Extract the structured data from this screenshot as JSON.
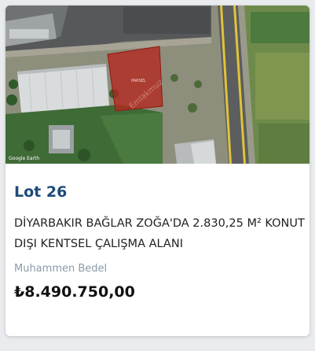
{
  "listing": {
    "image_caption": "Google Earth",
    "parcel_label": "PARSEL",
    "lot_label": "Lot 26",
    "title": "DİYARBAKIR BAĞLAR ZOĞA'DA 2.830,25 M² KONUT DIŞI KENTSEL ÇALIŞMA ALANI",
    "estimate_label": "Muhammen Bedel",
    "price": "₺8.490.750,00"
  },
  "colors": {
    "lot_title": "#1d4a7a",
    "estimate_label": "#8a9aa9",
    "parcel_fill": "#b3261e",
    "card_background": "#ffffff"
  }
}
